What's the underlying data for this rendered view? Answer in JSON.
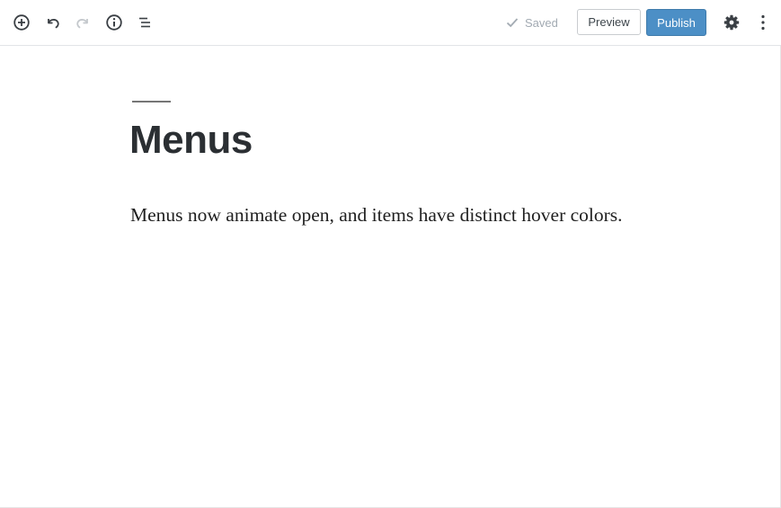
{
  "toolbar": {
    "icons": {
      "add": "plus-circle-icon",
      "undo": "undo-icon",
      "redo": "redo-icon",
      "info": "info-icon",
      "outline": "list-outline-icon",
      "settings": "gear-icon",
      "more": "more-vertical-icon"
    },
    "saved_label": "Saved",
    "preview_label": "Preview",
    "publish_label": "Publish"
  },
  "post": {
    "title": "Menus",
    "body": "Menus now animate open, and items have distinct hover colors."
  },
  "colors": {
    "publish_bg": "#4c8fc6",
    "icon": "#555d66",
    "icon_disabled": "#c4c8cc",
    "saved_text": "#a2aab2",
    "title": "#2b2f33"
  }
}
